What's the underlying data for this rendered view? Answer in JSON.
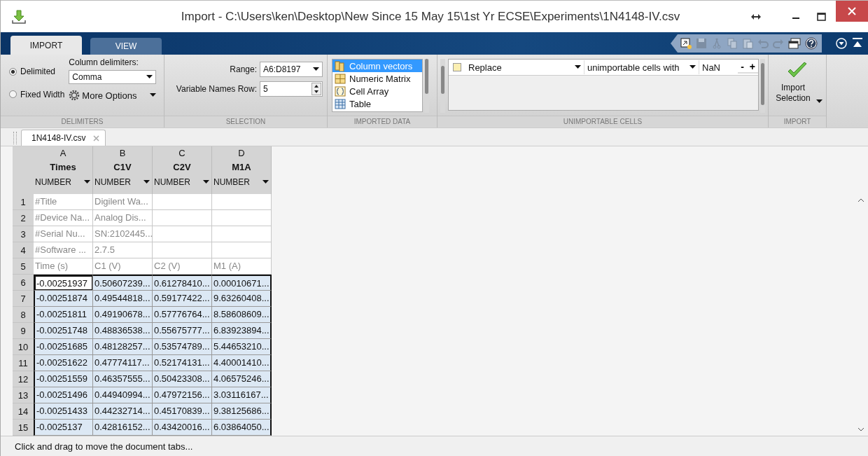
{
  "window": {
    "title": "Import - C:\\Users\\ken\\Desktop\\New Since 15 May 15\\1st Yr ECSE\\Experiments\\1N4148-IV.csv"
  },
  "tabs": [
    {
      "label": "IMPORT",
      "selected": true
    },
    {
      "label": "VIEW",
      "selected": false
    }
  ],
  "delimiters": {
    "options": [
      {
        "label": "Delimited",
        "selected": true
      },
      {
        "label": "Fixed Width",
        "selected": false
      }
    ],
    "column_delimiters_label": "Column delimiters:",
    "column_delimiters_value": "Comma",
    "more_options": "More Options",
    "section_label": "DELIMITERS"
  },
  "selection": {
    "range_label": "Range:",
    "range_value": "A6:D8197",
    "names_row_label": "Variable Names Row:",
    "names_row_value": "5",
    "section_label": "SELECTION"
  },
  "imported_data": {
    "items": [
      {
        "label": "Column vectors",
        "selected": true
      },
      {
        "label": "Numeric Matrix",
        "selected": false
      },
      {
        "label": "Cell Array",
        "selected": false
      },
      {
        "label": "Table",
        "selected": false
      }
    ],
    "section_label": "IMPORTED DATA"
  },
  "unimportable": {
    "rule": {
      "checked": false,
      "action": "Replace",
      "target": "unimportable cells with",
      "value": "NaN",
      "remove": "-",
      "add": "+"
    },
    "section_label": "UNIMPORTABLE CELLS"
  },
  "import": {
    "button": "Import Selection",
    "section_label": "IMPORT"
  },
  "document_tabs": [
    {
      "label": "1N4148-IV.csv",
      "selected": true
    }
  ],
  "table": {
    "columns": [
      {
        "letter": "A",
        "name": "Times",
        "type": "NUMBER"
      },
      {
        "letter": "B",
        "name": "C1V",
        "type": "NUMBER"
      },
      {
        "letter": "C",
        "name": "C2V",
        "type": "NUMBER"
      },
      {
        "letter": "D",
        "name": "M1A",
        "type": "NUMBER"
      }
    ],
    "rows": [
      {
        "number": "1",
        "selected": false,
        "active": false,
        "cells": [
          "#Title",
          "Digilent Wa...",
          "",
          ""
        ]
      },
      {
        "number": "2",
        "selected": false,
        "active": false,
        "cells": [
          "#Device Na...",
          "Analog Dis...",
          "",
          ""
        ]
      },
      {
        "number": "3",
        "selected": false,
        "active": false,
        "cells": [
          "#Serial Nu...",
          "SN:2102445...",
          "",
          ""
        ]
      },
      {
        "number": "4",
        "selected": false,
        "active": false,
        "cells": [
          "#Software ...",
          "2.7.5",
          "",
          ""
        ]
      },
      {
        "number": "5",
        "selected": false,
        "active": false,
        "cells": [
          "Time (s)",
          "C1 (V)",
          "C2 (V)",
          "M1 (A)"
        ]
      },
      {
        "number": "6",
        "selected": true,
        "active": true,
        "cells": [
          "-0.00251937",
          "0.50607239...",
          "0.61278410...",
          "0.00010671..."
        ]
      },
      {
        "number": "7",
        "selected": true,
        "active": false,
        "cells": [
          "-0.00251874",
          "0.49544818...",
          "0.59177422...",
          "9.63260408..."
        ]
      },
      {
        "number": "8",
        "selected": true,
        "active": false,
        "cells": [
          "-0.00251811",
          "0.49190678...",
          "0.57776764...",
          "8.58608609..."
        ]
      },
      {
        "number": "9",
        "selected": true,
        "active": false,
        "cells": [
          "-0.00251748",
          "0.48836538...",
          "0.55675777...",
          "6.83923894..."
        ]
      },
      {
        "number": "10",
        "selected": true,
        "active": false,
        "cells": [
          "-0.00251685",
          "0.48128257...",
          "0.53574789...",
          "5.44653210..."
        ]
      },
      {
        "number": "11",
        "selected": true,
        "active": false,
        "cells": [
          "-0.00251622",
          "0.47774117...",
          "0.52174131...",
          "4.40001410..."
        ]
      },
      {
        "number": "12",
        "selected": true,
        "active": false,
        "cells": [
          "-0.00251559",
          "0.46357555...",
          "0.50423308...",
          "4.06575246..."
        ]
      },
      {
        "number": "13",
        "selected": true,
        "active": false,
        "cells": [
          "-0.00251496",
          "0.44940994...",
          "0.47972156...",
          "3.03116167..."
        ]
      },
      {
        "number": "14",
        "selected": true,
        "active": false,
        "cells": [
          "-0.00251433",
          "0.44232714...",
          "0.45170839...",
          "9.38125686..."
        ]
      },
      {
        "number": "15",
        "selected": true,
        "active": false,
        "cells": [
          "-0.0025137",
          "0.42816152...",
          "0.43420016...",
          "6.03864050..."
        ]
      }
    ]
  },
  "status_bar": "Click and drag to move the document tabs..."
}
